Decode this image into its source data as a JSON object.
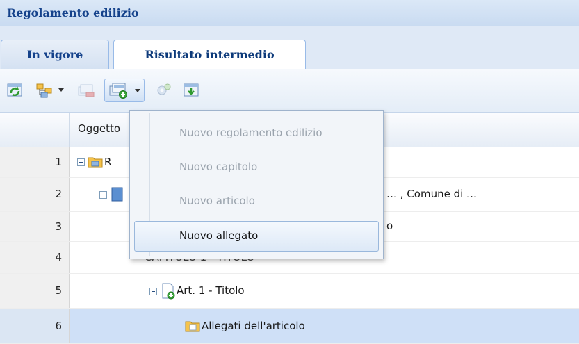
{
  "window": {
    "title": "Regolamento edilizio"
  },
  "tabs": [
    {
      "label": "In vigore",
      "active": false
    },
    {
      "label": "Risultato intermedio",
      "active": true
    }
  ],
  "toolbar": {
    "buttons": [
      {
        "icon": "refresh-icon",
        "has_menu": false
      },
      {
        "icon": "tree-structure-icon",
        "has_menu": true
      },
      {
        "icon": "delete-item-icon",
        "has_menu": false,
        "disabled": true
      },
      {
        "icon": "add-item-icon",
        "has_menu": true,
        "pressed": true
      },
      {
        "icon": "settings-icon",
        "has_menu": false
      },
      {
        "icon": "export-icon",
        "has_menu": false
      }
    ]
  },
  "grid": {
    "column_header": "Oggetto",
    "rows": [
      {
        "num": "1",
        "text": "R",
        "icon": "folder-icon"
      },
      {
        "num": "2",
        "text": "… , Comune di …",
        "icon": "document-icon"
      },
      {
        "num": "3",
        "text": "o",
        "icon": ""
      },
      {
        "num": "4",
        "text": "CAPITOLO 1 - TITOLO",
        "icon": "chapter-icon"
      },
      {
        "num": "5",
        "text": "Art. 1 - Titolo",
        "icon": "article-icon"
      },
      {
        "num": "6",
        "text": "Allegati dell'articolo",
        "icon": "attachments-folder-icon",
        "selected": true
      }
    ]
  },
  "menu": {
    "items": [
      {
        "label": "Nuovo regolamento edilizio",
        "enabled": false
      },
      {
        "label": "Nuovo capitolo",
        "enabled": false
      },
      {
        "label": "Nuovo articolo",
        "enabled": false
      },
      {
        "label": "Nuovo allegato",
        "enabled": true,
        "highlighted": true
      }
    ]
  },
  "colors": {
    "title_text": "#15428b",
    "header_bg": "#dfe9f6",
    "selection_bg": "#cfe0f7",
    "menu_disabled_text": "#9aa3ad"
  }
}
